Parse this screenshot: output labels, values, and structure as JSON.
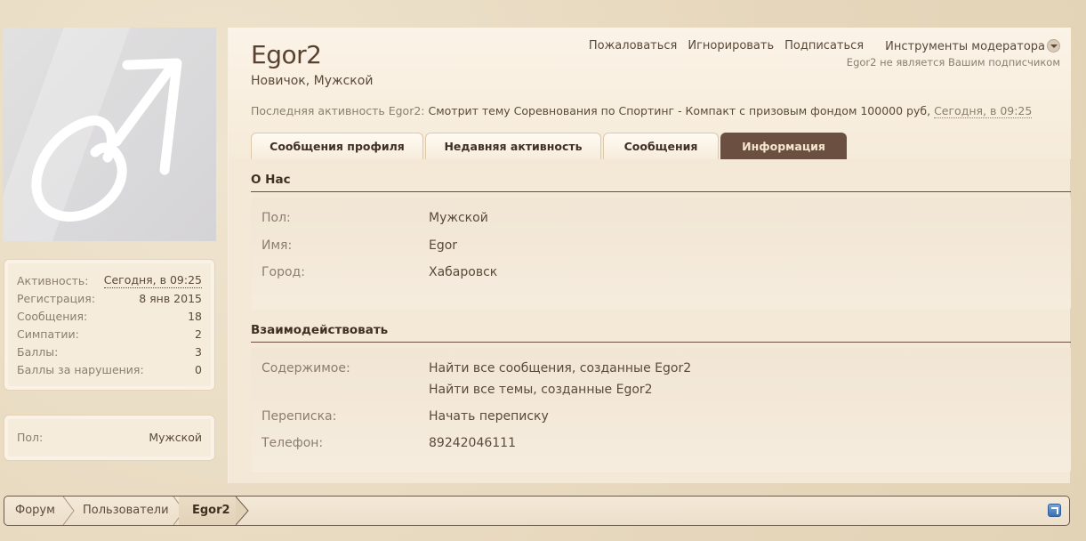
{
  "profile": {
    "username": "Egor2",
    "user_title": "Новичок, Мужской",
    "last_activity_label": "Последняя активность Egor2:",
    "last_activity_text": "Смотрит тему Соревнования по Спортинг - Компакт с призовым фондом 100000 руб,",
    "last_activity_time": "Сегодня, в 09:25",
    "follow_note": "Egor2 не является Вашим подписчиком",
    "actions": {
      "report": "Пожаловаться",
      "ignore": "Игнорировать",
      "follow": "Подписаться",
      "moderator_tools": "Инструменты модератора"
    }
  },
  "tabs": [
    {
      "label": "Сообщения профиля",
      "active": false
    },
    {
      "label": "Недавняя активность",
      "active": false
    },
    {
      "label": "Сообщения",
      "active": false
    },
    {
      "label": "Информация",
      "active": true
    }
  ],
  "sidebar": {
    "stats": [
      {
        "label": "Активность:",
        "value": "Сегодня, в 09:25"
      },
      {
        "label": "Регистрация:",
        "value": "8 янв 2015"
      },
      {
        "label": "Сообщения:",
        "value": "18"
      },
      {
        "label": "Симпатии:",
        "value": "2"
      },
      {
        "label": "Баллы:",
        "value": "3"
      },
      {
        "label": "Баллы за нарушения:",
        "value": "0"
      }
    ],
    "gender": {
      "label": "Пол:",
      "value": "Мужской"
    }
  },
  "about": {
    "title": "О Нас",
    "rows": [
      {
        "label": "Пол:",
        "value": "Мужской"
      },
      {
        "label": "Имя:",
        "value": "Egor"
      },
      {
        "label": "Город:",
        "value": "Хабаровск"
      }
    ]
  },
  "interact": {
    "title": "Взаимодействовать",
    "content_label": "Содержимое:",
    "find_posts": "Найти все сообщения, созданные Egor2",
    "find_threads": "Найти все темы, созданные Egor2",
    "conversation_label": "Переписка:",
    "conversation_link": "Начать переписку",
    "phone_label": "Телефон:",
    "phone_value": "89242046111"
  },
  "breadcrumb": [
    {
      "label": "Форум"
    },
    {
      "label": "Пользователи"
    },
    {
      "label": "Egor2"
    }
  ],
  "colors": {
    "accent": "#6b4f40",
    "background": "#e9dcc3",
    "panel": "#f4e8d6"
  }
}
